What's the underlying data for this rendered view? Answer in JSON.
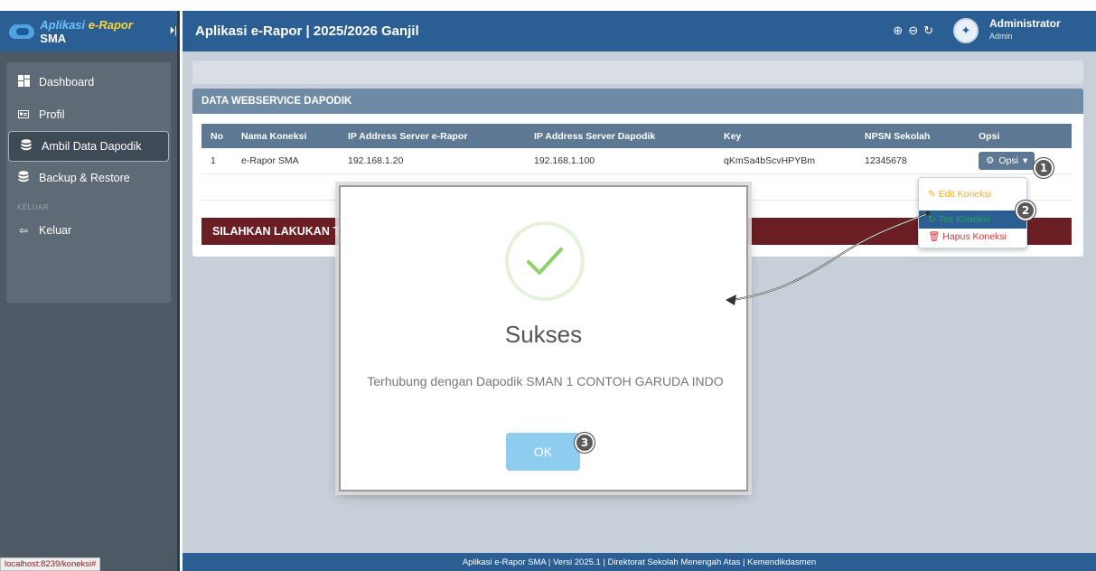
{
  "sidebar": {
    "brand": {
      "part1": "Aplikasi",
      "part2": "e-Rapor",
      "part3": "SMA"
    },
    "items": [
      {
        "label": "Dashboard",
        "icon": "dashboard-icon"
      },
      {
        "label": "Profil",
        "icon": "profile-card-icon"
      },
      {
        "label": "Ambil Data Dapodik",
        "icon": "database-icon",
        "active": true
      },
      {
        "label": "Backup & Restore",
        "icon": "database-icon"
      }
    ],
    "section_label": "KELUAR",
    "logout_label": "Keluar"
  },
  "header": {
    "title": "Aplikasi e-Rapor | 2025/2026 Ganjil",
    "user_name": "Administrator",
    "user_role": "Admin"
  },
  "panel": {
    "title": "DATA WEBSERVICE DAPODIK",
    "columns": [
      "No",
      "Nama Koneksi",
      "IP Address Server e-Rapor",
      "IP Address Server Dapodik",
      "Key",
      "NPSN Sekolah",
      "Opsi"
    ],
    "rows": [
      {
        "no": "1",
        "name": "e-Rapor SMA",
        "ip_erapor": "192.168.1.20",
        "ip_dapodik": "192.168.1.100",
        "key": "qKmSa4bScvHPYBm",
        "npsn": "12345678"
      }
    ],
    "options_label": "Opsi",
    "banner": "SILAHKAN LAKUKAN TE"
  },
  "dropdown": {
    "edit": "Edit Koneksi",
    "test": "Tes Koneksi",
    "delete": "Hapus Koneksi"
  },
  "modal": {
    "title": "Sukses",
    "message": "Terhubung dengan Dapodik SMAN 1 CONTOH GARUDA INDO",
    "ok_label": "OK"
  },
  "badges": [
    "1",
    "2",
    "3"
  ],
  "footer": {
    "text": "Aplikasi e-Rapor SMA | Versi 2025.1 | Direktorat Sekolah Menengah Atas | Kemendikdasmen"
  },
  "status_url": "localhost:8239/koneksi#",
  "colors": {
    "header": "#2b5f93",
    "sidebar": "#4d5a66",
    "table_head": "#5d7893",
    "banner": "#6b1f24",
    "success": "#8fd16a",
    "ok_button": "#8ecdf0"
  }
}
